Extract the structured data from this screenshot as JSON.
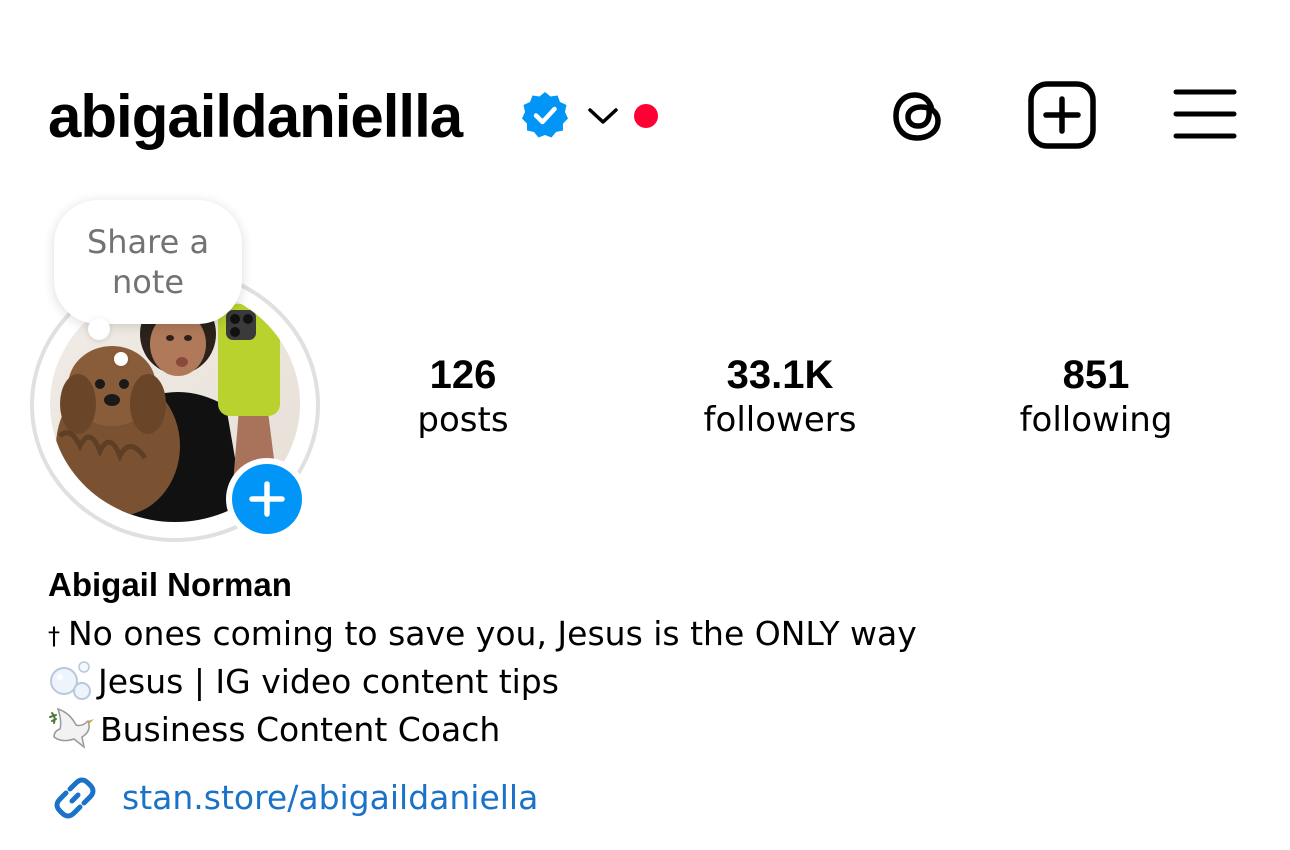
{
  "header": {
    "username": "abigaildaniellla",
    "verified_icon": "verified-badge-icon",
    "dropdown_icon": "chevron-down-icon",
    "live_indicator_color": "#ff0034",
    "actions": [
      {
        "name": "threads-button",
        "icon": "threads-icon"
      },
      {
        "name": "create-button",
        "icon": "plus-square-icon"
      },
      {
        "name": "menu-button",
        "icon": "hamburger-menu-icon"
      }
    ]
  },
  "profile": {
    "note_prompt": "Share a note",
    "avatar": "profile-photo",
    "add_story_icon": "plus-icon"
  },
  "stats": {
    "posts": {
      "value": "126",
      "label": "posts"
    },
    "followers": {
      "value": "33.1K",
      "label": "followers"
    },
    "following": {
      "value": "851",
      "label": "following"
    }
  },
  "bio": {
    "display_name": "Abigail Norman",
    "lines": [
      {
        "prefix": "†",
        "text": "No ones coming to save you, Jesus is the ONLY way"
      },
      {
        "icon": "bubbles-icon",
        "text": "Jesus | IG video content tips"
      },
      {
        "icon": "dove-icon",
        "text": "Business Content Coach"
      }
    ],
    "link": {
      "icon": "link-icon",
      "text": "stan.store/abigaildaniella"
    }
  },
  "colors": {
    "accent_blue": "#0095f6",
    "link_blue": "#1a73c9",
    "verified_blue": "#0095f6",
    "live_red": "#ff0034",
    "muted_text": "#737373"
  }
}
